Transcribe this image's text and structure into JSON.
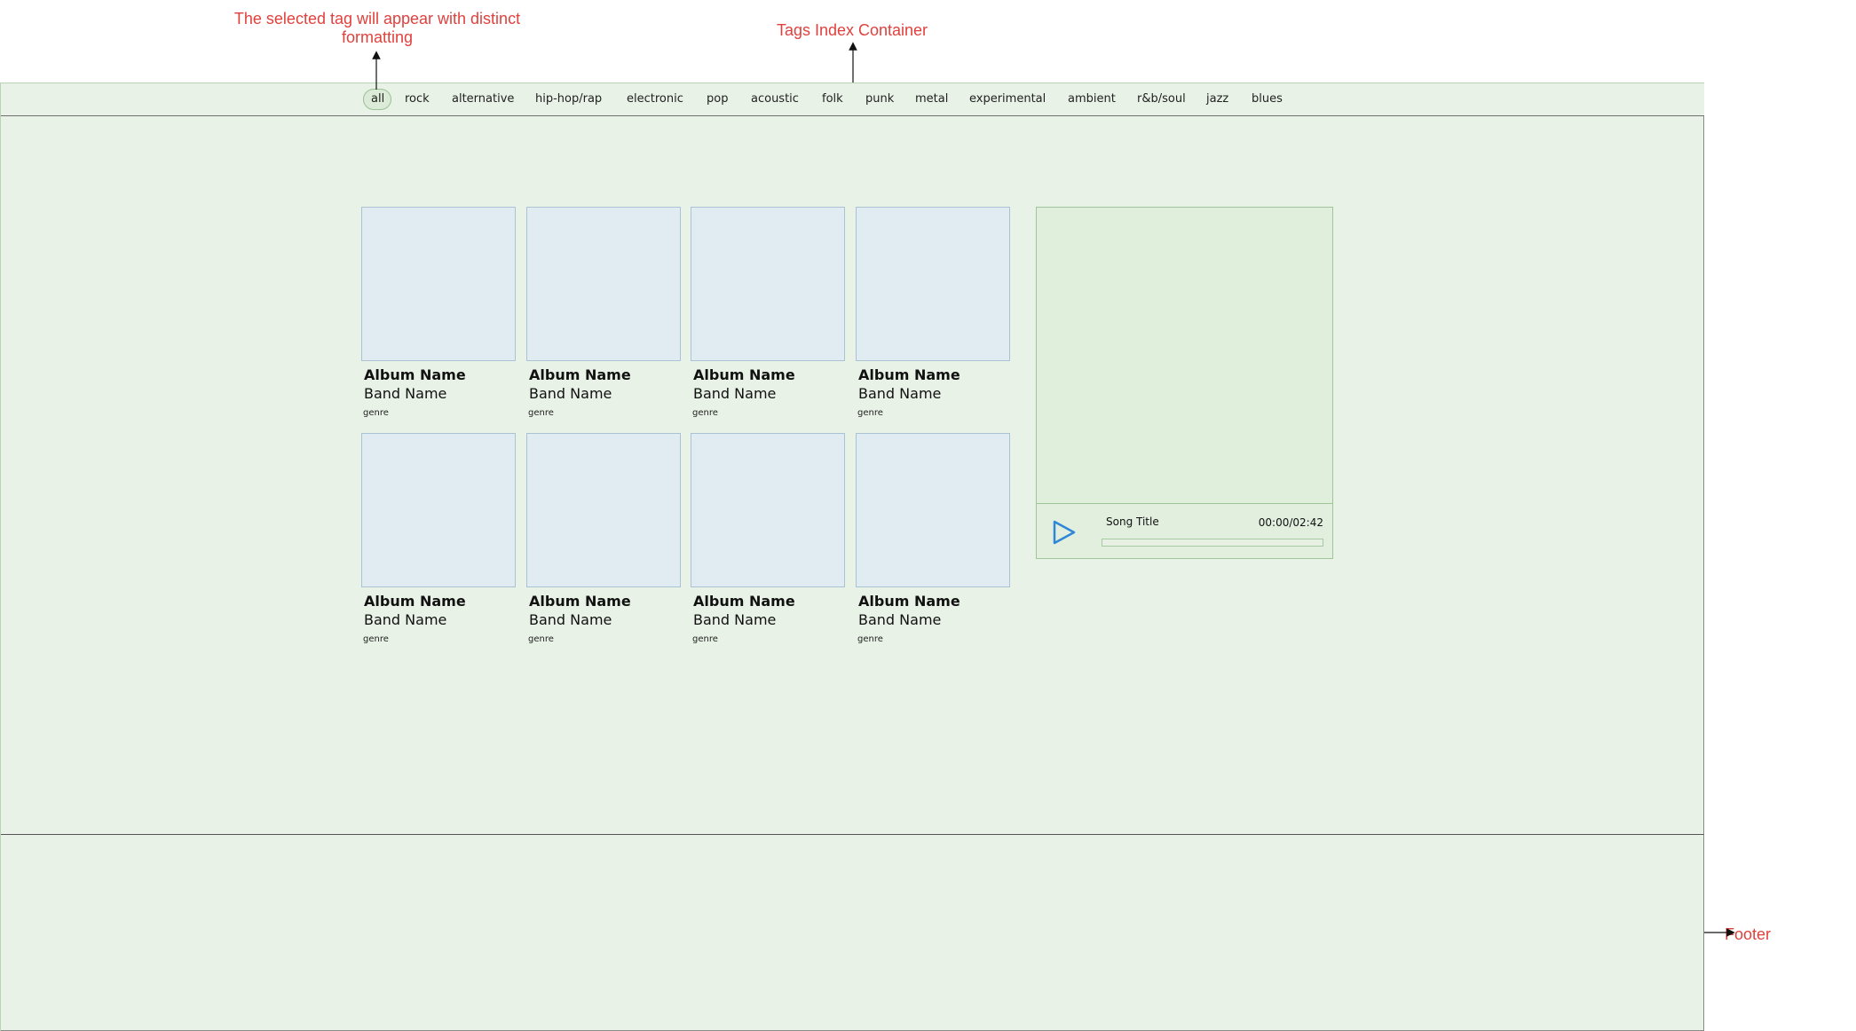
{
  "annotations": {
    "selected_tag": "The selected tag will appear with distinct formatting",
    "tags_container": "Tags Index Container",
    "footer": "Footer"
  },
  "tags": [
    {
      "label": "all",
      "selected": true
    },
    {
      "label": "rock",
      "selected": false
    },
    {
      "label": "alternative",
      "selected": false
    },
    {
      "label": "hip-hop/rap",
      "selected": false
    },
    {
      "label": "electronic",
      "selected": false
    },
    {
      "label": "pop",
      "selected": false
    },
    {
      "label": "acoustic",
      "selected": false
    },
    {
      "label": "folk",
      "selected": false
    },
    {
      "label": "punk",
      "selected": false
    },
    {
      "label": "metal",
      "selected": false
    },
    {
      "label": "experimental",
      "selected": false
    },
    {
      "label": "ambient",
      "selected": false
    },
    {
      "label": "r&b/soul",
      "selected": false
    },
    {
      "label": "jazz",
      "selected": false
    },
    {
      "label": "blues",
      "selected": false
    }
  ],
  "albums": [
    {
      "album": "Album Name",
      "band": "Band Name",
      "genre": "genre"
    },
    {
      "album": "Album Name",
      "band": "Band Name",
      "genre": "genre"
    },
    {
      "album": "Album Name",
      "band": "Band Name",
      "genre": "genre"
    },
    {
      "album": "Album Name",
      "band": "Band Name",
      "genre": "genre"
    },
    {
      "album": "Album Name",
      "band": "Band Name",
      "genre": "genre"
    },
    {
      "album": "Album Name",
      "band": "Band Name",
      "genre": "genre"
    },
    {
      "album": "Album Name",
      "band": "Band Name",
      "genre": "genre"
    },
    {
      "album": "Album Name",
      "band": "Band Name",
      "genre": "genre"
    }
  ],
  "player": {
    "song_title": "Song Title",
    "time": "00:00/02:42",
    "progress": 0,
    "play_icon": "play-icon"
  },
  "colors": {
    "annotation": "#e0413d",
    "background": "#e8f2e6",
    "cover": "#e0ecf2",
    "play_icon": "#2e88d6"
  }
}
